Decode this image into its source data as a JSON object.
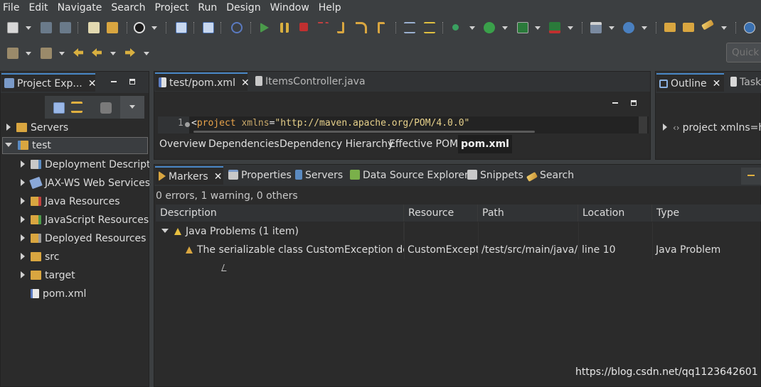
{
  "menu": [
    "File",
    "Edit",
    "Navigate",
    "Search",
    "Project",
    "Run",
    "Design",
    "Window",
    "Help"
  ],
  "quick_access": {
    "placeholder": "Quick"
  },
  "project_explorer": {
    "tab_label": "Project Exp...",
    "tree": [
      {
        "label": "Servers",
        "icon": "folder-icon",
        "expanded": false,
        "level": 0
      },
      {
        "label": "test",
        "icon": "project-icon",
        "expanded": true,
        "level": 0,
        "selected": true
      },
      {
        "label": "Deployment Descriptor",
        "icon": "deployment-icon",
        "expanded": false,
        "level": 1
      },
      {
        "label": "JAX-WS Web Services",
        "icon": "webservice-icon",
        "expanded": false,
        "level": 1
      },
      {
        "label": "Java Resources",
        "icon": "java-resources-icon",
        "expanded": false,
        "level": 1
      },
      {
        "label": "JavaScript Resources",
        "icon": "js-resources-icon",
        "expanded": false,
        "level": 1
      },
      {
        "label": "Deployed Resources",
        "icon": "deployed-icon",
        "expanded": false,
        "level": 1
      },
      {
        "label": "src",
        "icon": "folder-icon",
        "expanded": false,
        "level": 1
      },
      {
        "label": "target",
        "icon": "folder-icon",
        "expanded": false,
        "level": 1
      },
      {
        "label": "pom.xml",
        "icon": "xml-file-icon",
        "expanded": null,
        "level": 1
      }
    ]
  },
  "editor": {
    "tabs": [
      {
        "label": "test/pom.xml",
        "active": true
      },
      {
        "label": "ItemsController.java",
        "active": false
      }
    ],
    "line_number": "1",
    "code": {
      "lt": "<",
      "tag": "project",
      "attr": "xmlns",
      "eq": "=",
      "value": "\"http://maven.apache.org/POM/4.0.0\""
    },
    "subtabs": [
      {
        "label": "Overview",
        "active": false
      },
      {
        "label": "Dependencies",
        "active": false
      },
      {
        "label": "Dependency Hierarchy",
        "active": false
      },
      {
        "label": "Effective POM",
        "active": false
      },
      {
        "label": "pom.xml",
        "active": true
      }
    ]
  },
  "outline": {
    "tabs": [
      {
        "label": "Outline",
        "active": true
      },
      {
        "label": "Task",
        "active": false
      }
    ],
    "item": "project xmlns=ht"
  },
  "bottom_panel": {
    "tabs": [
      {
        "label": "Markers",
        "active": true
      },
      {
        "label": "Properties",
        "active": false
      },
      {
        "label": "Servers",
        "active": false
      },
      {
        "label": "Data Source Explorer",
        "active": false
      },
      {
        "label": "Snippets",
        "active": false
      },
      {
        "label": "Search",
        "active": false
      }
    ],
    "summary": "0 errors, 1 warning, 0 others",
    "columns": [
      "Description",
      "Resource",
      "Path",
      "Location",
      "Type"
    ],
    "group": "Java Problems (1 item)",
    "rows": [
      {
        "description": "The serializable class CustomException does n",
        "resource": "CustomExceptio",
        "path": "/test/src/main/java/cc",
        "location": "line 10",
        "type": "Java Problem"
      }
    ]
  },
  "watermark": "https://blog.csdn.net/qq1123642601",
  "colors": {
    "accent": "#4a88c7",
    "xml_tag": "#e8a34a",
    "xml_attr": "#c8a86a",
    "xml_value": "#e6d08a",
    "warning": "#e8c040"
  }
}
